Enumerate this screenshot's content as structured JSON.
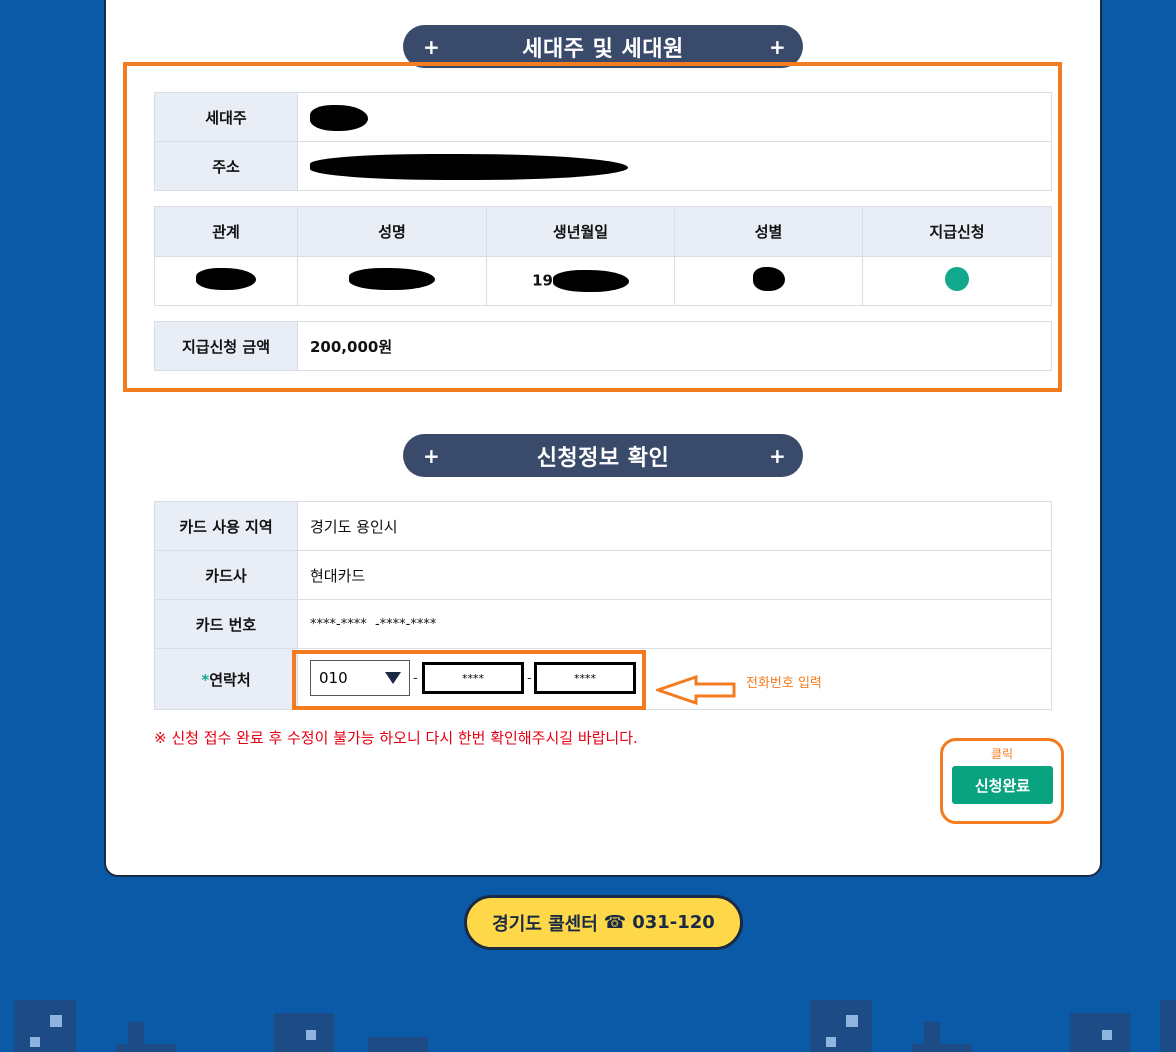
{
  "household": {
    "section_title": "세대주 및 세대원",
    "plus": "+",
    "head_label": "세대주",
    "address_label": "주소",
    "members_headers": [
      "관계",
      "성명",
      "생년월일",
      "성별",
      "지급신청"
    ],
    "member_birth_prefix": "19",
    "amount_label": "지급신청 금액",
    "amount_value": "200,000원"
  },
  "application": {
    "section_title": "신청정보 확인",
    "card_region_label": "카드 사용 지역",
    "card_region_value": "경기도 용인시",
    "card_company_label": "카드사",
    "card_company_value": "현대카드",
    "card_number_label": "카드 번호",
    "card_number_value": "****-****  -****-****",
    "contact_required_mark": "*",
    "contact_label": "연락처",
    "phone_prefix": "010",
    "phone_middle": "****",
    "phone_last": "****",
    "phone_dash": "-",
    "phone_hint": "전화번호 입력"
  },
  "warning": "※ 신청 접수 완료 후 수정이 불가능 하오니 다시 한번 확인해주시길 바랍니다.",
  "submit": {
    "click_label": "클릭",
    "button_label": "신청완료"
  },
  "callcenter": {
    "label": "경기도 콜센터",
    "phone_icon": "☎",
    "number": "031-120"
  },
  "colors": {
    "background": "#0b5aa8",
    "section_pill": "#3a4a6b",
    "accent_green": "#0aa37f",
    "highlight_orange": "#f47c20",
    "warning_red": "#e60012",
    "callcenter_yellow": "#ffd84a"
  }
}
